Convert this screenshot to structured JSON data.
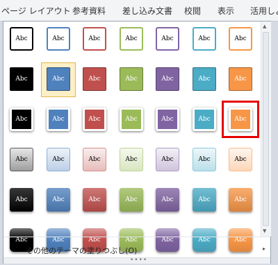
{
  "ribbon": {
    "tabs": [
      "ページ レイアウト",
      "参考資料",
      "差し込み文書",
      "校閲",
      "表示",
      "活用しよ"
    ]
  },
  "gallery": {
    "cell_label": "Abc",
    "theme_colors": [
      "#000000",
      "#4f81bd",
      "#c0504d",
      "#9bbb59",
      "#8064a2",
      "#4bacc6",
      "#f79646"
    ],
    "style_rows": [
      "outline",
      "fill-bordered",
      "fill-white-frame",
      "light-gradient",
      "dark-gradient",
      "glossy"
    ],
    "hover_cell": {
      "row": 1,
      "col": 1
    },
    "highlighted_cell": {
      "row": 2,
      "col": 6
    }
  },
  "menu": {
    "more_fills_label": "その他のテーマの塗りつぶし(O)"
  },
  "icons": {
    "scroll_up": "▲",
    "scroll_down": "▼",
    "submenu_arrow": "▸",
    "grip": "••••"
  }
}
